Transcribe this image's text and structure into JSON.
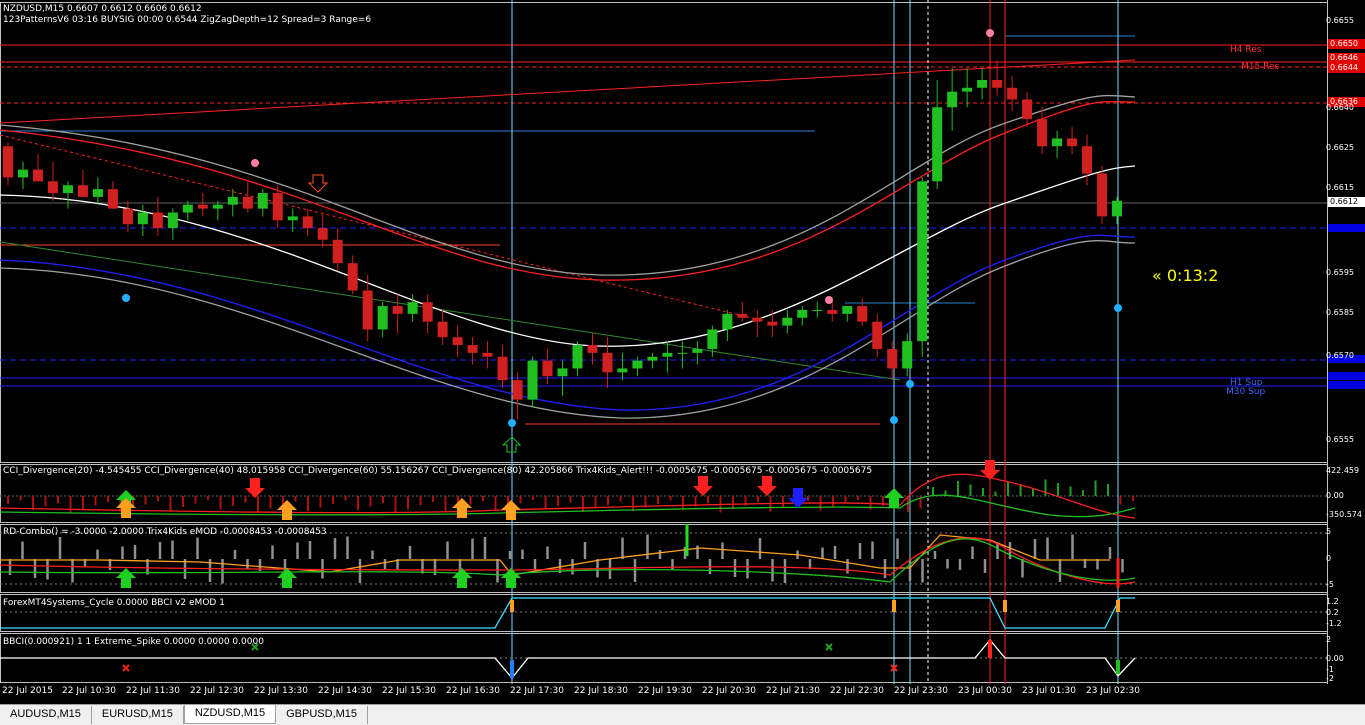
{
  "header": {
    "symbol_line": "NZDUSD,M15  0.6607 0.6612 0.6606 0.6612",
    "pattern_line": "123PatternsV6  03:16  BUYSIG  00:00  0.6544  ZigZagDepth=12  Spread=3  Range=6"
  },
  "price_axis": {
    "ticks": [
      "0.6655",
      "0.6640",
      "0.6625",
      "0.6615",
      "0.6595",
      "0.6585",
      "0.6570",
      "0.6555"
    ],
    "current_price": "0.6612",
    "tags": [
      "0.6650",
      "0.6646",
      "0.6644",
      "0.6636"
    ]
  },
  "levels": {
    "h4_res": "H4 Res",
    "m15_res": "M15 Res",
    "h1_sup": "H1 Sup",
    "m30_sup": "M30 Sup"
  },
  "countdown": "« 0:13:2",
  "time_axis": [
    "22 Jul 2015",
    "22 Jul 10:30",
    "22 Jul 11:30",
    "22 Jul 12:30",
    "22 Jul 13:30",
    "22 Jul 14:30",
    "22 Jul 15:30",
    "22 Jul 16:30",
    "22 Jul 17:30",
    "22 Jul 18:30",
    "22 Jul 19:30",
    "22 Jul 20:30",
    "22 Jul 21:30",
    "22 Jul 22:30",
    "22 Jul 23:30",
    "23 Jul 00:30",
    "23 Jul 01:30",
    "23 Jul 02:30"
  ],
  "panels": {
    "cci": {
      "label": "CCI_Divergence(20) -4.545455  CCI_Divergence(40) 48.015958  CCI_Divergence(60) 55.156267  CCI_Divergence(80) 42.205866  Trix4Kids_Alert!!! -0.0005675 -0.0005675 -0.0005675 -0.0005675",
      "ticks": [
        "422.459",
        "0.00",
        "-350.574"
      ]
    },
    "rd": {
      "label": "RD-Combo() = -3.0000 -2.0000  Trix4Kids eMOD -0.0008453 -0.0008453",
      "ticks": [
        "5",
        "0",
        "-5"
      ]
    },
    "cycle": {
      "label": "ForexMT4Systems_Cycle 0.0000  BBCI v2 eMOD 1",
      "ticks": [
        "1.2",
        "0.2",
        "-1.2"
      ]
    },
    "bbci": {
      "label": "BBCI(0.000921) 1 1  Extreme_Spike 0.0000 0.0000 0.0000",
      "ticks": [
        "2",
        "0.00",
        "-1",
        "-2"
      ]
    }
  },
  "tabs": [
    "AUDUSD,M15",
    "EURUSD,M15",
    "NZDUSD,M15",
    "GBPUSD,M15"
  ],
  "active_tab": "NZDUSD,M15",
  "chart_data": {
    "type": "candlestick",
    "symbol": "NZDUSD",
    "timeframe": "M15",
    "ylim": [
      0.6547,
      0.6665
    ],
    "candles": [
      [
        0.6628,
        0.6629,
        0.6618,
        0.662
      ],
      [
        0.662,
        0.6624,
        0.6617,
        0.6622
      ],
      [
        0.6622,
        0.6626,
        0.6619,
        0.6619
      ],
      [
        0.6619,
        0.6624,
        0.6614,
        0.6616
      ],
      [
        0.6616,
        0.6619,
        0.6612,
        0.6618
      ],
      [
        0.6618,
        0.6622,
        0.6615,
        0.6615
      ],
      [
        0.6615,
        0.662,
        0.6613,
        0.6617
      ],
      [
        0.6617,
        0.6619,
        0.6612,
        0.6612
      ],
      [
        0.6612,
        0.6614,
        0.6606,
        0.6608
      ],
      [
        0.6608,
        0.6613,
        0.6605,
        0.6611
      ],
      [
        0.6611,
        0.6615,
        0.6605,
        0.6607
      ],
      [
        0.6607,
        0.6612,
        0.6604,
        0.6611
      ],
      [
        0.6611,
        0.6614,
        0.6609,
        0.6613
      ],
      [
        0.6613,
        0.6616,
        0.661,
        0.6612
      ],
      [
        0.6612,
        0.6614,
        0.6609,
        0.6613
      ],
      [
        0.6613,
        0.6617,
        0.661,
        0.6615
      ],
      [
        0.6615,
        0.6619,
        0.6611,
        0.6612
      ],
      [
        0.6612,
        0.6617,
        0.661,
        0.6616
      ],
      [
        0.6616,
        0.6618,
        0.6607,
        0.6609
      ],
      [
        0.6609,
        0.6612,
        0.6606,
        0.661
      ],
      [
        0.661,
        0.6612,
        0.6605,
        0.6607
      ],
      [
        0.6607,
        0.6611,
        0.6602,
        0.6604
      ],
      [
        0.6604,
        0.6607,
        0.6596,
        0.6598
      ],
      [
        0.6598,
        0.66,
        0.659,
        0.6591
      ],
      [
        0.6591,
        0.6595,
        0.6578,
        0.6581
      ],
      [
        0.6581,
        0.6588,
        0.6579,
        0.6587
      ],
      [
        0.6587,
        0.659,
        0.658,
        0.6585
      ],
      [
        0.6585,
        0.659,
        0.6583,
        0.6588
      ],
      [
        0.6588,
        0.659,
        0.658,
        0.6583
      ],
      [
        0.6583,
        0.6586,
        0.6577,
        0.6579
      ],
      [
        0.6579,
        0.6582,
        0.6574,
        0.6577
      ],
      [
        0.6577,
        0.6579,
        0.6572,
        0.6575
      ],
      [
        0.6575,
        0.6578,
        0.6571,
        0.6574
      ],
      [
        0.6574,
        0.6577,
        0.6566,
        0.6568
      ],
      [
        0.6568,
        0.657,
        0.6558,
        0.6563
      ],
      [
        0.6563,
        0.6574,
        0.6561,
        0.6573
      ],
      [
        0.6573,
        0.6576,
        0.6567,
        0.6569
      ],
      [
        0.6569,
        0.6573,
        0.6564,
        0.6571
      ],
      [
        0.6571,
        0.6578,
        0.6569,
        0.6577
      ],
      [
        0.6577,
        0.658,
        0.6572,
        0.6575
      ],
      [
        0.6575,
        0.6579,
        0.6566,
        0.657
      ],
      [
        0.657,
        0.6575,
        0.6568,
        0.6571
      ],
      [
        0.6571,
        0.6574,
        0.6569,
        0.6573
      ],
      [
        0.6573,
        0.6575,
        0.6571,
        0.6574
      ],
      [
        0.6574,
        0.6578,
        0.657,
        0.6575
      ],
      [
        0.6575,
        0.6578,
        0.6571,
        0.6575
      ],
      [
        0.6575,
        0.6578,
        0.6572,
        0.6576
      ],
      [
        0.6576,
        0.6582,
        0.6574,
        0.6581
      ],
      [
        0.6581,
        0.6586,
        0.6578,
        0.6585
      ],
      [
        0.6585,
        0.6588,
        0.6583,
        0.6584
      ],
      [
        0.6584,
        0.6586,
        0.6579,
        0.6583
      ],
      [
        0.6583,
        0.6586,
        0.6579,
        0.6582
      ],
      [
        0.6582,
        0.6586,
        0.658,
        0.6584
      ],
      [
        0.6584,
        0.6587,
        0.6582,
        0.6586
      ],
      [
        0.6586,
        0.6588,
        0.6584,
        0.6586
      ],
      [
        0.6586,
        0.6588,
        0.6583,
        0.6585
      ],
      [
        0.6585,
        0.6587,
        0.6583,
        0.6587
      ],
      [
        0.6587,
        0.6589,
        0.6582,
        0.6583
      ],
      [
        0.6583,
        0.6585,
        0.6574,
        0.6576
      ],
      [
        0.6576,
        0.6578,
        0.6568,
        0.6571
      ],
      [
        0.6571,
        0.658,
        0.6569,
        0.6578
      ],
      [
        0.6578,
        0.662,
        0.6574,
        0.6619
      ],
      [
        0.6619,
        0.6645,
        0.6617,
        0.6638
      ],
      [
        0.6638,
        0.6648,
        0.6632,
        0.6642
      ],
      [
        0.6642,
        0.6648,
        0.6638,
        0.6643
      ],
      [
        0.6643,
        0.6648,
        0.664,
        0.6645
      ],
      [
        0.6645,
        0.665,
        0.6641,
        0.6643
      ],
      [
        0.6643,
        0.6646,
        0.6637,
        0.664
      ],
      [
        0.664,
        0.6642,
        0.6633,
        0.6635
      ],
      [
        0.6635,
        0.6638,
        0.6626,
        0.6628
      ],
      [
        0.6628,
        0.6632,
        0.6625,
        0.663
      ],
      [
        0.663,
        0.6633,
        0.6626,
        0.6628
      ],
      [
        0.6628,
        0.6631,
        0.6618,
        0.6621
      ],
      [
        0.6621,
        0.6623,
        0.6608,
        0.661
      ],
      [
        0.661,
        0.6615,
        0.6608,
        0.6614
      ]
    ]
  }
}
